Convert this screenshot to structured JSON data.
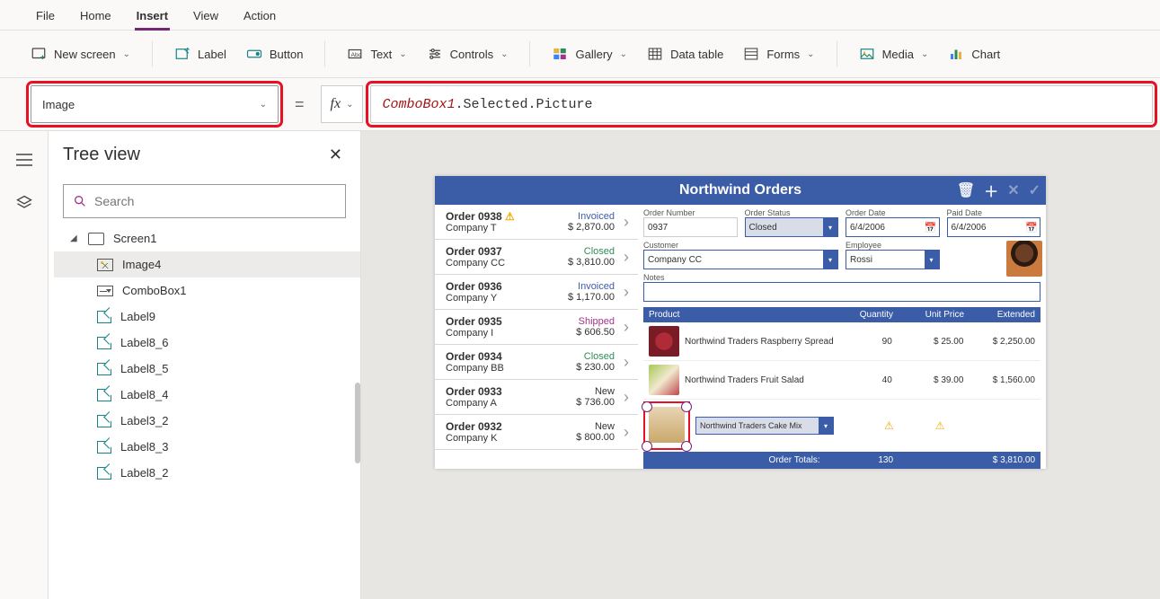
{
  "menu": {
    "file": "File",
    "home": "Home",
    "insert": "Insert",
    "view": "View",
    "action": "Action"
  },
  "ribbon": {
    "new_screen": "New screen",
    "label": "Label",
    "button": "Button",
    "text": "Text",
    "controls": "Controls",
    "gallery": "Gallery",
    "data_table": "Data table",
    "forms": "Forms",
    "media": "Media",
    "chart": "Chart"
  },
  "property_dropdown": "Image",
  "formula": {
    "obj": "ComboBox1",
    "rest": ".Selected.Picture"
  },
  "tree": {
    "title": "Tree view",
    "search_placeholder": "Search",
    "screen": "Screen1",
    "items": [
      "Image4",
      "ComboBox1",
      "Label9",
      "Label8_6",
      "Label8_5",
      "Label8_4",
      "Label3_2",
      "Label8_3",
      "Label8_2"
    ]
  },
  "app": {
    "title": "Northwind Orders",
    "orders": [
      {
        "name": "Order 0938",
        "company": "Company T",
        "status": "Invoiced",
        "status_hex": "#3b5ca7",
        "amount": "$ 2,870.00",
        "warn": true
      },
      {
        "name": "Order 0937",
        "company": "Company CC",
        "status": "Closed",
        "status_hex": "#2e8b57",
        "amount": "$ 3,810.00",
        "warn": false
      },
      {
        "name": "Order 0936",
        "company": "Company Y",
        "status": "Invoiced",
        "status_hex": "#3b5ca7",
        "amount": "$ 1,170.00",
        "warn": false
      },
      {
        "name": "Order 0935",
        "company": "Company I",
        "status": "Shipped",
        "status_hex": "#a4328a",
        "amount": "$ 606.50",
        "warn": false
      },
      {
        "name": "Order 0934",
        "company": "Company BB",
        "status": "Closed",
        "status_hex": "#2e8b57",
        "amount": "$ 230.00",
        "warn": false
      },
      {
        "name": "Order 0933",
        "company": "Company A",
        "status": "New",
        "status_hex": "#333333",
        "amount": "$ 736.00",
        "warn": false
      },
      {
        "name": "Order 0932",
        "company": "Company K",
        "status": "New",
        "status_hex": "#333333",
        "amount": "$ 800.00",
        "warn": false
      }
    ],
    "detail": {
      "labels": {
        "order_number": "Order Number",
        "order_status": "Order Status",
        "order_date": "Order Date",
        "paid_date": "Paid Date",
        "customer": "Customer",
        "employee": "Employee",
        "notes": "Notes"
      },
      "order_number": "0937",
      "order_status": "Closed",
      "order_date": "6/4/2006",
      "paid_date": "6/4/2006",
      "customer": "Company CC",
      "employee": "Rossi",
      "notes": ""
    },
    "prod_head": {
      "product": "Product",
      "qty": "Quantity",
      "unit": "Unit Price",
      "ext": "Extended"
    },
    "products": [
      {
        "name": "Northwind Traders Raspberry Spread",
        "qty": "90",
        "unit": "$ 25.00",
        "ext": "$ 2,250.00"
      },
      {
        "name": "Northwind Traders Fruit Salad",
        "qty": "40",
        "unit": "$ 39.00",
        "ext": "$ 1,560.00"
      }
    ],
    "sel_combo": "Northwind Traders Cake Mix",
    "totals": {
      "label": "Order Totals:",
      "qty": "130",
      "ext": "$ 3,810.00"
    }
  }
}
